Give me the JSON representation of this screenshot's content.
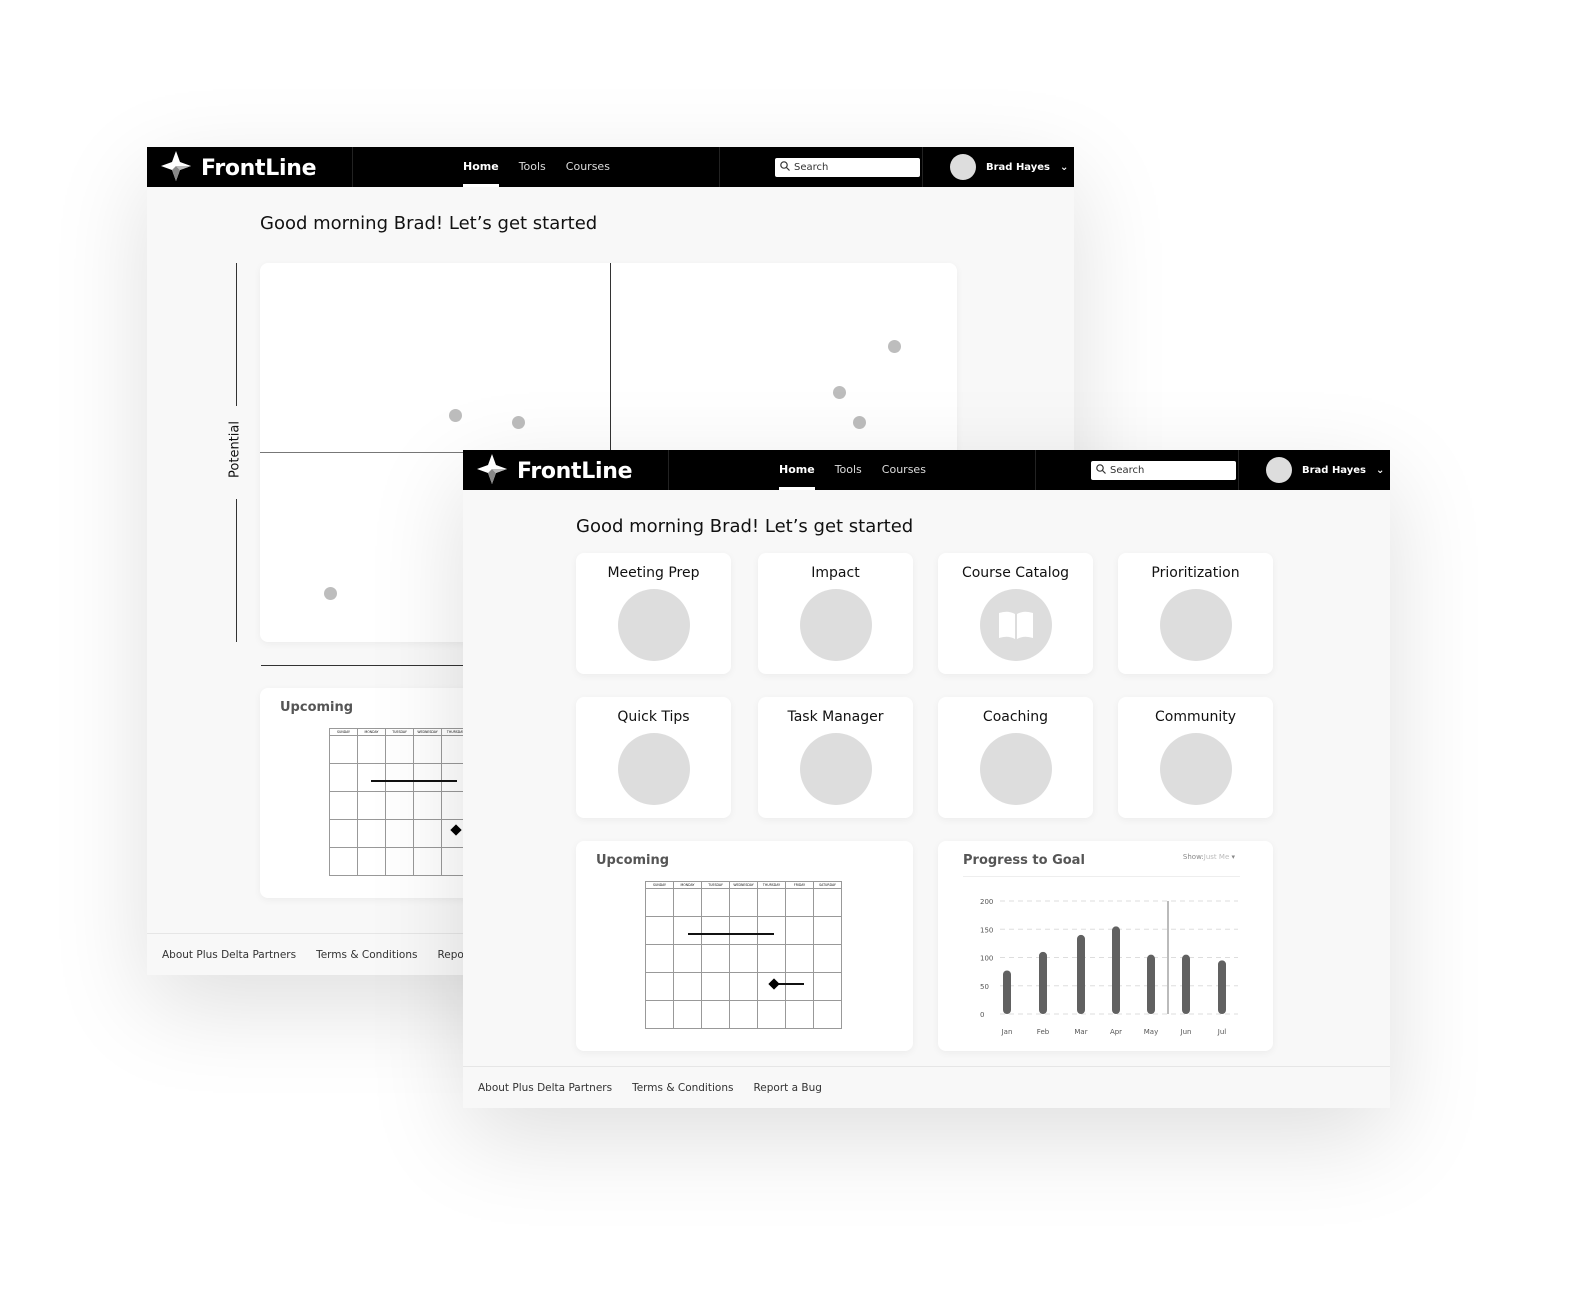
{
  "app": {
    "brand": "FrontLine",
    "nav": [
      "Home",
      "Tools",
      "Courses"
    ],
    "active_nav": "Home",
    "search_placeholder": "Search",
    "user_name": "Brad Hayes"
  },
  "greeting": "Good morning Brad! Let’s get started",
  "tiles": [
    {
      "label": "Meeting Prep",
      "icon": "circle"
    },
    {
      "label": "Impact",
      "icon": "circle"
    },
    {
      "label": "Course Catalog",
      "icon": "book-icon"
    },
    {
      "label": "Prioritization",
      "icon": "circle"
    },
    {
      "label": "Quick Tips",
      "icon": "circle"
    },
    {
      "label": "Task Manager",
      "icon": "circle"
    },
    {
      "label": "Coaching",
      "icon": "circle"
    },
    {
      "label": "Community",
      "icon": "circle"
    }
  ],
  "upcoming": {
    "title": "Upcoming",
    "days": [
      "SUNDAY",
      "MONDAY",
      "TUESDAY",
      "WEDNESDAY",
      "THURSDAY",
      "FRIDAY",
      "SATURDAY"
    ]
  },
  "progress": {
    "title": "Progress to Goal",
    "filter_label": "Show:",
    "filter_value": "Just Me"
  },
  "footer": [
    "About Plus Delta Partners",
    "Terms & Conditions",
    "Report a Bug"
  ],
  "chart_data": [
    {
      "type": "bar",
      "title": "Progress to Goal",
      "categories": [
        "Jan",
        "Feb",
        "Mar",
        "Apr",
        "May",
        "Jun",
        "Jul"
      ],
      "values": [
        77,
        110,
        140,
        155,
        105,
        105,
        95
      ],
      "yticks": [
        0,
        50,
        100,
        150,
        200
      ],
      "ylim": [
        0,
        200
      ],
      "grid": true,
      "marker_between": [
        "May",
        "Jun"
      ],
      "bar_color": "#616161"
    },
    {
      "type": "scatter",
      "ylabel": "Potential",
      "quadrants": true,
      "points": [
        [
          28,
          60
        ],
        [
          37,
          58
        ],
        [
          83,
          66
        ],
        [
          86,
          58
        ],
        [
          91,
          78
        ],
        [
          10,
          13
        ]
      ],
      "xlim": [
        0,
        100
      ],
      "ylim": [
        0,
        100
      ],
      "point_color": "#bdbdbd"
    }
  ]
}
